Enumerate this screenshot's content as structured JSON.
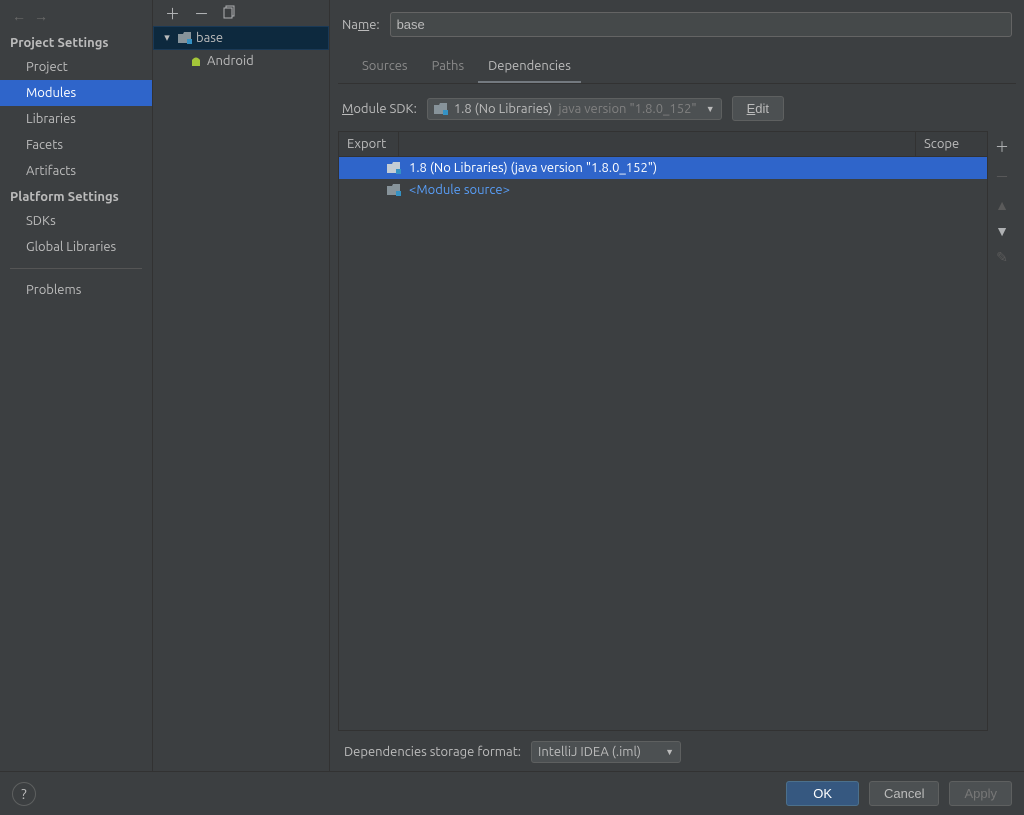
{
  "nav": {
    "project_settings_label": "Project Settings",
    "platform_settings_label": "Platform Settings",
    "items_project": "Project",
    "items_modules": "Modules",
    "items_libraries": "Libraries",
    "items_facets": "Facets",
    "items_artifacts": "Artifacts",
    "items_sdks": "SDKs",
    "items_global_libs": "Global Libraries",
    "items_problems": "Problems"
  },
  "tree": {
    "root": "base",
    "child": "Android"
  },
  "detail": {
    "name_label_pre": "Na",
    "name_label_u": "m",
    "name_label_post": "e:",
    "name_value": "base",
    "tabs": {
      "sources": "Sources",
      "paths": "Paths",
      "dependencies": "Dependencies"
    },
    "sdk_label_u": "M",
    "sdk_label_post": "odule SDK:",
    "sdk_value_main": "1.8 (No Libraries)",
    "sdk_value_dim": "java version \"1.8.0_152\"",
    "edit_u": "E",
    "edit_post": "dit",
    "col_export": "Export",
    "col_scope": "Scope",
    "dep_row_1": "1.8 (No Libraries) (java version \"1.8.0_152\")",
    "dep_row_2": "<Module source>",
    "storage_label": "Dependencies storage format:",
    "storage_value": "IntelliJ IDEA (.iml)"
  },
  "footer": {
    "ok": "OK",
    "cancel": "Cancel",
    "apply": "Apply"
  }
}
